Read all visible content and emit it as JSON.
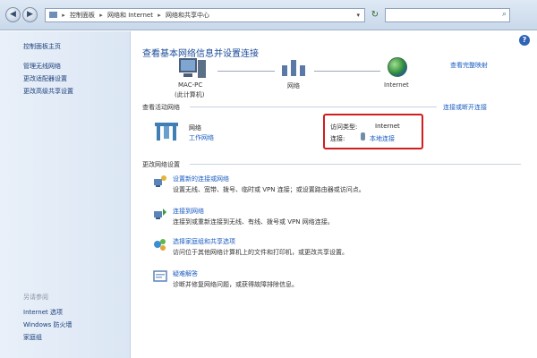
{
  "breadcrumb": [
    "控制面板",
    "网络和 Internet",
    "网络和共享中心"
  ],
  "sidebar": {
    "home": "控制面板主页",
    "items": [
      "管理无线网络",
      "更改适配器设置",
      "更改高级共享设置"
    ],
    "see_also_heading": "另请参阅",
    "see_also": [
      "Internet 选项",
      "Windows 防火墙",
      "家庭组"
    ]
  },
  "main": {
    "title": "查看基本网络信息并设置连接",
    "full_map_link": "查看完整映射",
    "nodes": [
      {
        "name": "MAC-PC",
        "sub": "(此计算机)"
      },
      {
        "name": "网络"
      },
      {
        "name": "Internet"
      }
    ],
    "active_section": "查看活动网络",
    "connect_link": "连接或断开连接",
    "network": {
      "name": "网络",
      "type": "工作网络"
    },
    "access": {
      "type_label": "访问类型:",
      "type_value": "Internet",
      "conn_label": "连接:",
      "conn_value": "本地连接"
    },
    "change_section": "更改网络设置",
    "tasks": [
      {
        "title": "设置新的连接或网络",
        "desc": "设置无线、宽带、拨号、临时或 VPN 连接；或设置路由器或访问点。",
        "icon": "setup-connection-icon"
      },
      {
        "title": "连接到网络",
        "desc": "连接到或重新连接到无线、有线、拨号或 VPN 网络连接。",
        "icon": "connect-network-icon"
      },
      {
        "title": "选择家庭组和共享选项",
        "desc": "访问位于其他网络计算机上的文件和打印机，或更改共享设置。",
        "icon": "homegroup-icon"
      },
      {
        "title": "疑难解答",
        "desc": "诊断并修复网络问题，或获得故障排除信息。",
        "icon": "troubleshoot-icon"
      }
    ]
  }
}
